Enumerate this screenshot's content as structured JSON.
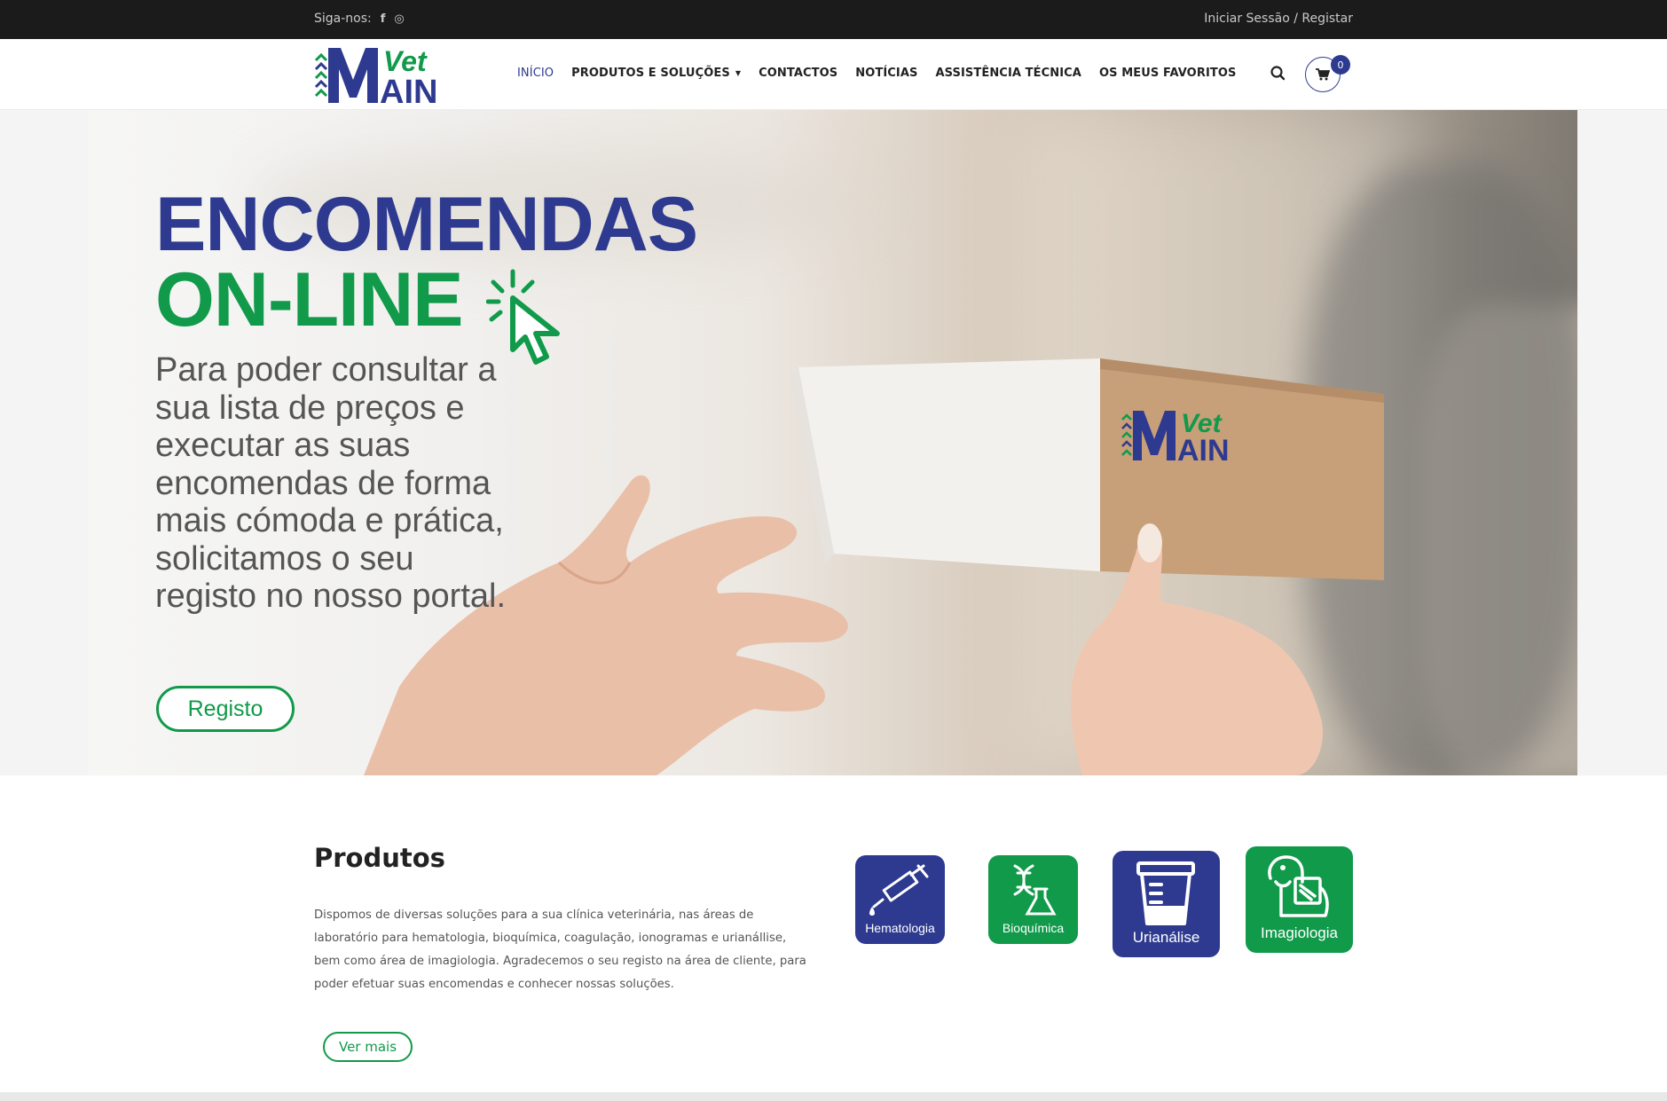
{
  "topbar": {
    "follow_label": "Siga-nos:",
    "social": [
      {
        "name": "facebook-icon",
        "glyph": "f"
      },
      {
        "name": "instagram-icon",
        "glyph": "◎"
      }
    ],
    "login_label": "Iniciar Sessão / Registar"
  },
  "header": {
    "logo_text_top": "Vet",
    "logo_text_main": "MAIN",
    "nav": [
      {
        "label": "INÍCIO",
        "active": true
      },
      {
        "label": "PRODUTOS E SOLUÇÕES",
        "dropdown": true
      },
      {
        "label": "CONTACTOS"
      },
      {
        "label": "NOTÍCIAS"
      },
      {
        "label": "ASSISTÊNCIA TÉCNICA"
      },
      {
        "label": "OS MEUS FAVORITOS"
      }
    ],
    "cart_count": "0"
  },
  "hero": {
    "title_line1": "ENCOMENDAS",
    "title_line2": "ON-LINE",
    "text": "Para poder consultar a sua lista de preços e executar as suas encomendas de forma mais cómoda e prática, solicitamos o seu registo no nosso portal.",
    "button_label": "Registo",
    "box_logo_top": "Vet",
    "box_logo_main": "MAIN",
    "slides_total": 2,
    "slide_active": 1
  },
  "produtos": {
    "title": "Produtos",
    "text": "Dispomos de diversas soluções para a sua clínica veterinária, nas áreas de laboratório para hematologia, bioquímica, coagulação, ionogramas e urianállise, bem como área de imagiologia. Agradecemos o seu registo na área de cliente, para poder efetuar suas encomendas e conhecer nossas soluções.",
    "button_label": "Ver mais",
    "tiles": [
      {
        "label": "Hematologia",
        "icon": "syringe-icon",
        "color": "#2e3a8f"
      },
      {
        "label": "Bioquímica",
        "icon": "dna-flask-icon",
        "color": "#109a4a"
      },
      {
        "label": "Urianálise",
        "icon": "urine-cup-icon",
        "color": "#2e3a8f"
      },
      {
        "label": "Imagiologia",
        "icon": "dog-xray-icon",
        "color": "#109a4a"
      }
    ]
  },
  "colors": {
    "brand_blue": "#2e3a8f",
    "brand_green": "#109a4a",
    "topbar": "#1b1b1b"
  }
}
